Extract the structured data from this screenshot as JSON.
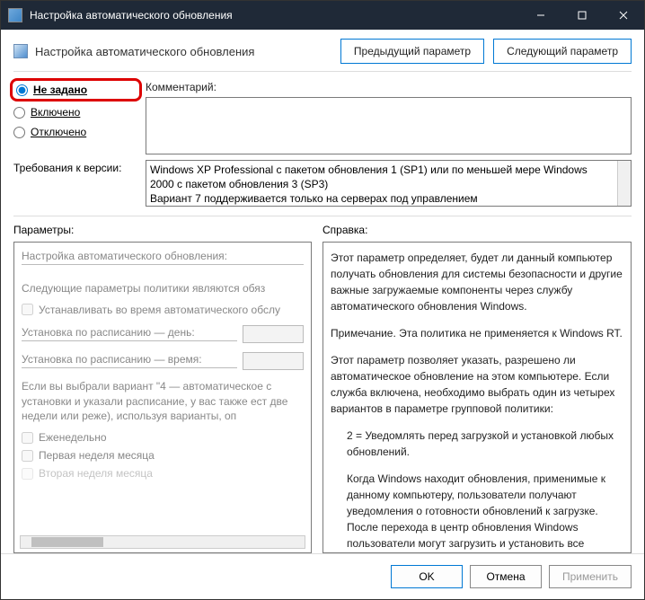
{
  "title": "Настройка автоматического обновления",
  "header": {
    "title": "Настройка автоматического обновления",
    "prev": "Предыдущий параметр",
    "next": "Следующий параметр"
  },
  "radios": {
    "not_set": "Не задано",
    "enabled": "Включено",
    "disabled": "Отключено"
  },
  "labels": {
    "comment": "Комментарий:",
    "requirements": "Требования к версии:",
    "params": "Параметры:",
    "help": "Справка:"
  },
  "requirements_text": "Windows XP Professional с пакетом обновления 1 (SP1) или по меньшей мере Windows 2000 с пакетом обновления 3 (SP3)\nВариант 7 поддерживается только на серверах под управлением",
  "params": {
    "title": "Настройка автоматического обновления:",
    "subtitle": "Следующие параметры политики являются обяз",
    "chk1": "Устанавливать во время автоматического обслу",
    "schedule_day": "Установка по расписанию — день:",
    "schedule_time": "Установка по расписанию — время:",
    "note": "Если вы выбрали вариант \"4 — автоматическое с установки и указали расписание, у вас также ест две недели или реже), используя варианты, оп",
    "chk_weekly": "Еженедельно",
    "chk_week1": "Первая неделя месяца",
    "chk_week2": "Вторая неделя месяца"
  },
  "help": {
    "p1": "Этот параметр определяет, будет ли данный компьютер получать обновления для системы безопасности и другие важные загружаемые компоненты через службу автоматического обновления Windows.",
    "p2": "Примечание. Эта политика не применяется к Windows RT.",
    "p3": "Этот параметр позволяет указать, разрешено ли автоматическое обновление на этом компьютере. Если служба включена, необходимо выбрать один из четырех вариантов в параметре групповой политики:",
    "p4": "2 = Уведомлять перед загрузкой и установкой любых обновлений.",
    "p5": "Когда Windows находит обновления, применимые к данному компьютеру, пользователи получают уведомления о готовности обновлений к загрузке. После перехода в центр обновления Windows пользователи могут загрузить и установить все доступные обновления."
  },
  "footer": {
    "ok": "OK",
    "cancel": "Отмена",
    "apply": "Применить"
  }
}
